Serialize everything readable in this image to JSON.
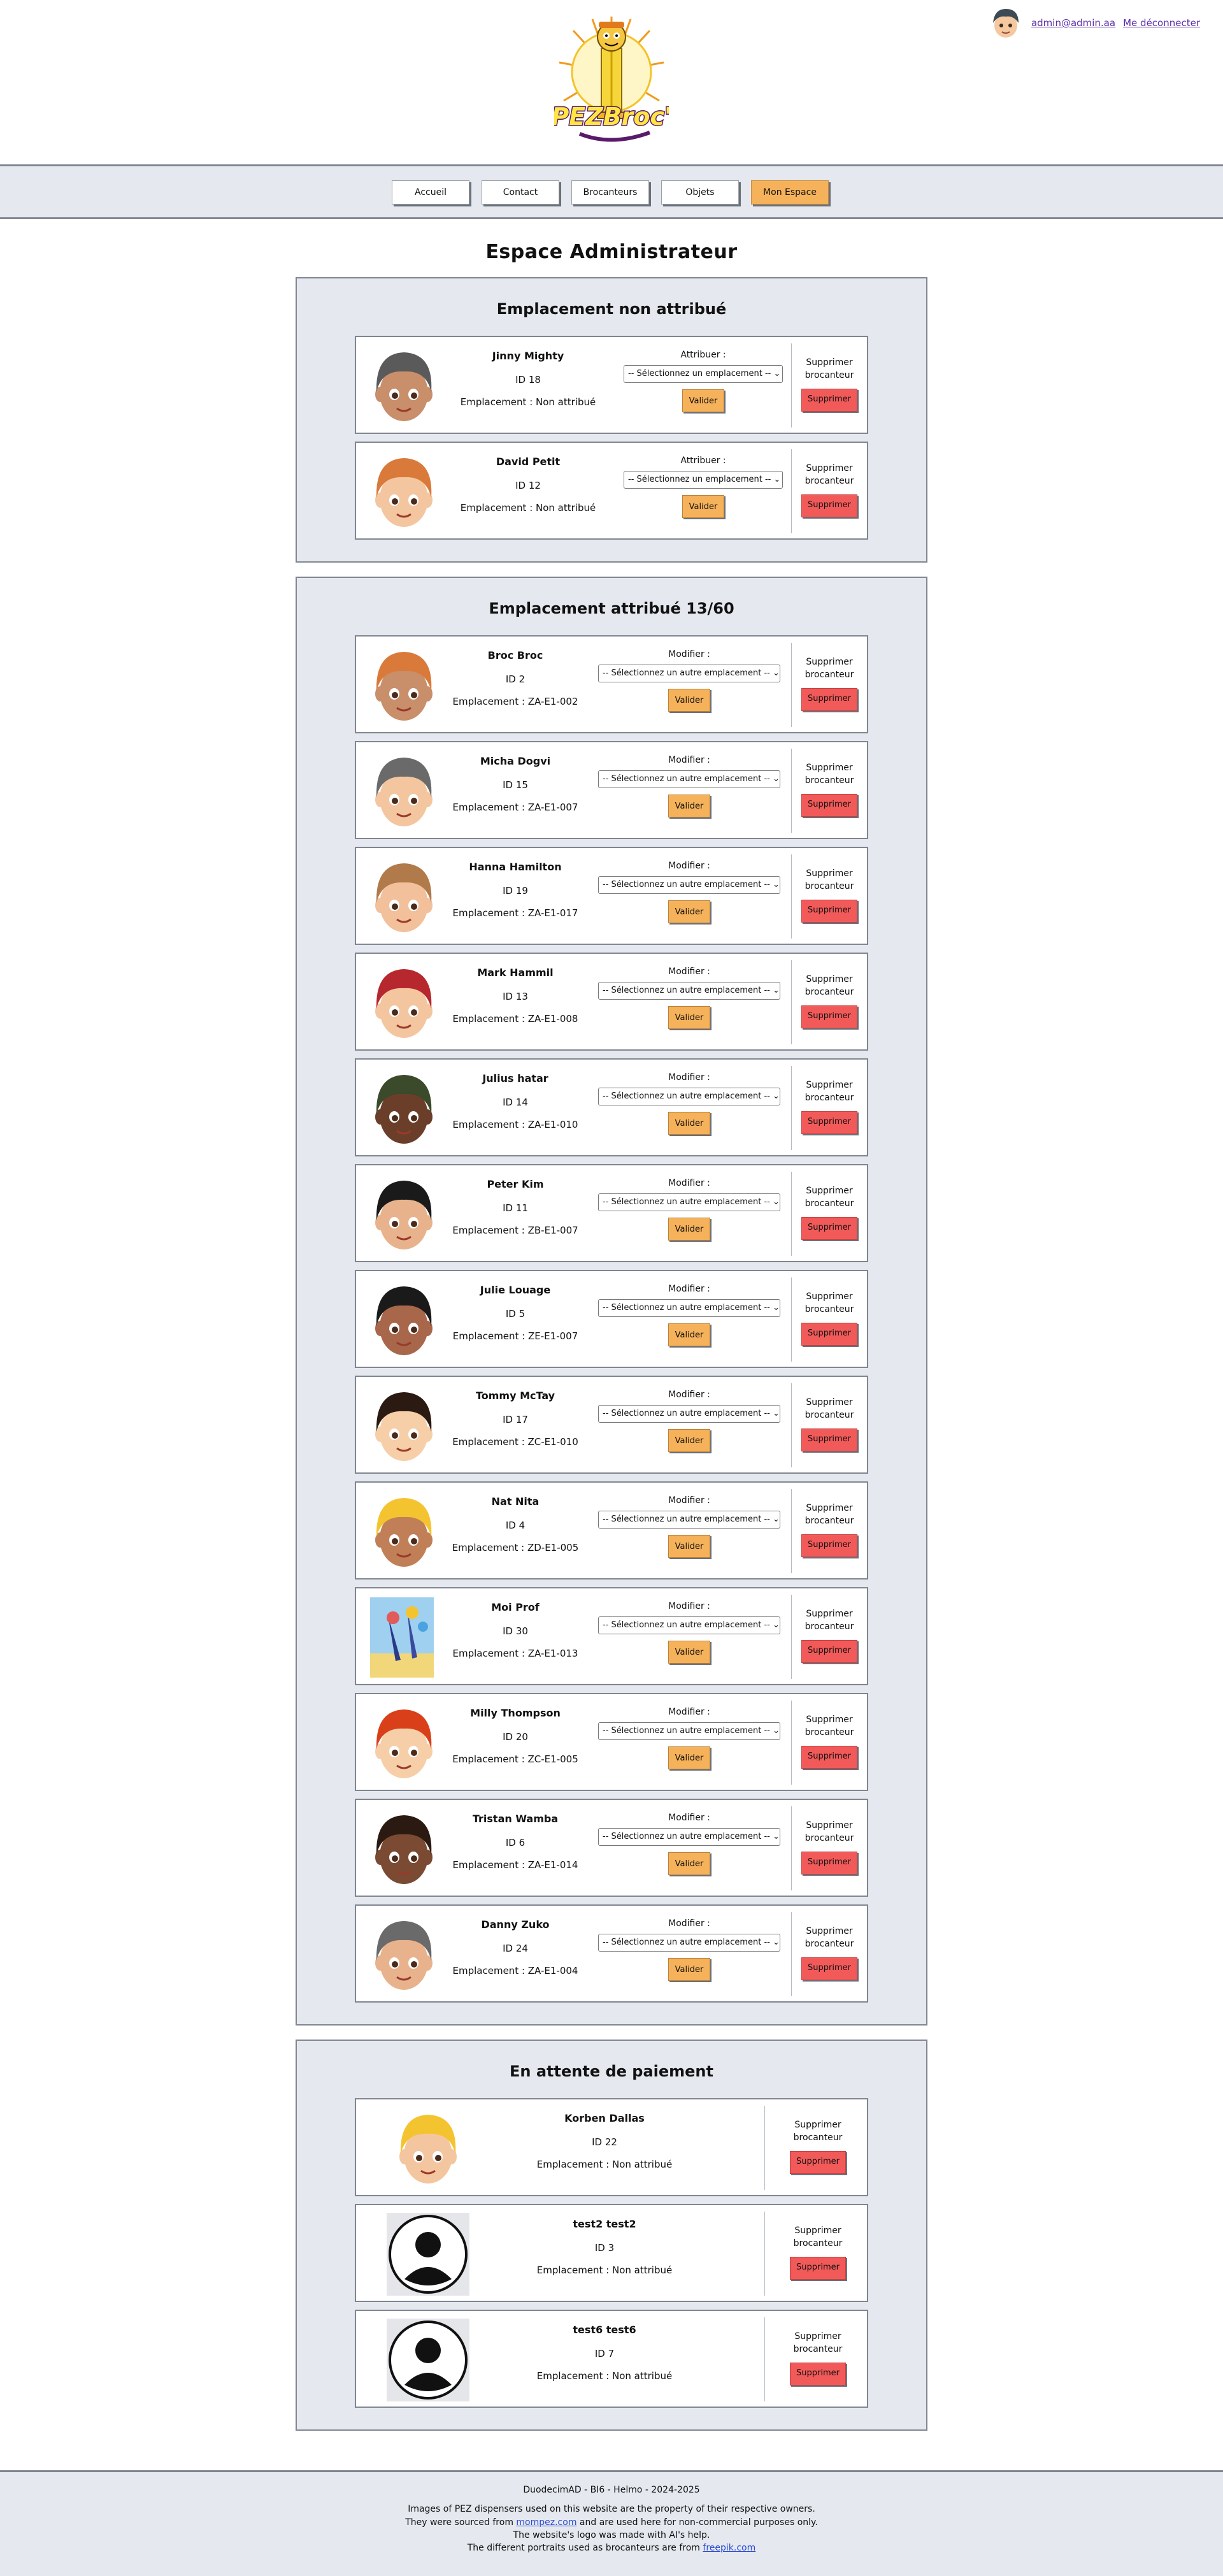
{
  "header": {
    "logo_text": "PEZBroc'",
    "user_email": "admin@admin.aa",
    "logout_label": "Me déconnecter"
  },
  "nav": {
    "items": [
      {
        "label": "Accueil"
      },
      {
        "label": "Contact"
      },
      {
        "label": "Brocanteurs"
      },
      {
        "label": "Objets"
      },
      {
        "label": "Mon Espace"
      }
    ]
  },
  "page_title": "Espace Administrateur",
  "unassigned": {
    "title": "Emplacement non attribué",
    "assign_label": "Attribuer :",
    "select_placeholder": "-- Sélectionnez un emplacement --",
    "validate_label": "Valider",
    "delete_text": "Supprimer brocanteur",
    "delete_label": "Supprimer",
    "people": [
      {
        "name": "Jinny Mighty",
        "id": "ID 18",
        "location": "Emplacement : Non attribué"
      },
      {
        "name": "David Petit",
        "id": "ID 12",
        "location": "Emplacement : Non attribué"
      }
    ]
  },
  "assigned": {
    "title": "Emplacement attribué 13/60",
    "modify_label": "Modifier :",
    "select_placeholder": "-- Sélectionnez un autre emplacement --",
    "validate_label": "Valider",
    "delete_text": "Supprimer brocanteur",
    "delete_label": "Supprimer",
    "people": [
      {
        "name": "Broc Broc",
        "id": "ID 2",
        "location": "Emplacement : ZA-E1-002"
      },
      {
        "name": "Micha Dogvi",
        "id": "ID 15",
        "location": "Emplacement : ZA-E1-007"
      },
      {
        "name": "Hanna Hamilton",
        "id": "ID 19",
        "location": "Emplacement : ZA-E1-017"
      },
      {
        "name": "Mark Hammil",
        "id": "ID 13",
        "location": "Emplacement : ZA-E1-008"
      },
      {
        "name": "Julius hatar",
        "id": "ID 14",
        "location": "Emplacement : ZA-E1-010"
      },
      {
        "name": "Peter Kim",
        "id": "ID 11",
        "location": "Emplacement : ZB-E1-007"
      },
      {
        "name": "Julie Louage",
        "id": "ID 5",
        "location": "Emplacement : ZE-E1-007"
      },
      {
        "name": "Tommy McTay",
        "id": "ID 17",
        "location": "Emplacement : ZC-E1-010"
      },
      {
        "name": "Nat Nita",
        "id": "ID 4",
        "location": "Emplacement : ZD-E1-005"
      },
      {
        "name": "Moi Prof",
        "id": "ID 30",
        "location": "Emplacement : ZA-E1-013"
      },
      {
        "name": "Milly Thompson",
        "id": "ID 20",
        "location": "Emplacement : ZC-E1-005"
      },
      {
        "name": "Tristan Wamba",
        "id": "ID 6",
        "location": "Emplacement : ZA-E1-014"
      },
      {
        "name": "Danny Zuko",
        "id": "ID 24",
        "location": "Emplacement : ZA-E1-004"
      }
    ]
  },
  "pending": {
    "title": "En attente de paiement",
    "delete_text": "Supprimer brocanteur",
    "delete_label": "Supprimer",
    "people": [
      {
        "name": "Korben Dallas",
        "id": "ID 22",
        "location": "Emplacement : Non attribué"
      },
      {
        "name": "test2 test2",
        "id": "ID 3",
        "location": "Emplacement : Non attribué"
      },
      {
        "name": "test6 test6",
        "id": "ID 7",
        "location": "Emplacement : Non attribué"
      }
    ]
  },
  "footer": {
    "line1": "DuodecimAD - BI6 - Helmo - 2024-2025",
    "line2": "Images of PEZ dispensers used on this website are the property of their respective owners.",
    "line3_pre": "They were sourced from ",
    "line3_link": "mompez.com",
    "line3_post": " and are used here for non-commercial purposes only.",
    "line4": "The website's logo was made with AI's help.",
    "line5_pre": "The different portraits used as brocanteurs are from ",
    "line5_link": "freepik.com"
  },
  "colors": {
    "accent_orange": "#f6b25a",
    "delete_red": "#f25a5a",
    "panel_bg": "#e5e9ef",
    "border": "#7f8691",
    "link": "#5b2fa8"
  }
}
